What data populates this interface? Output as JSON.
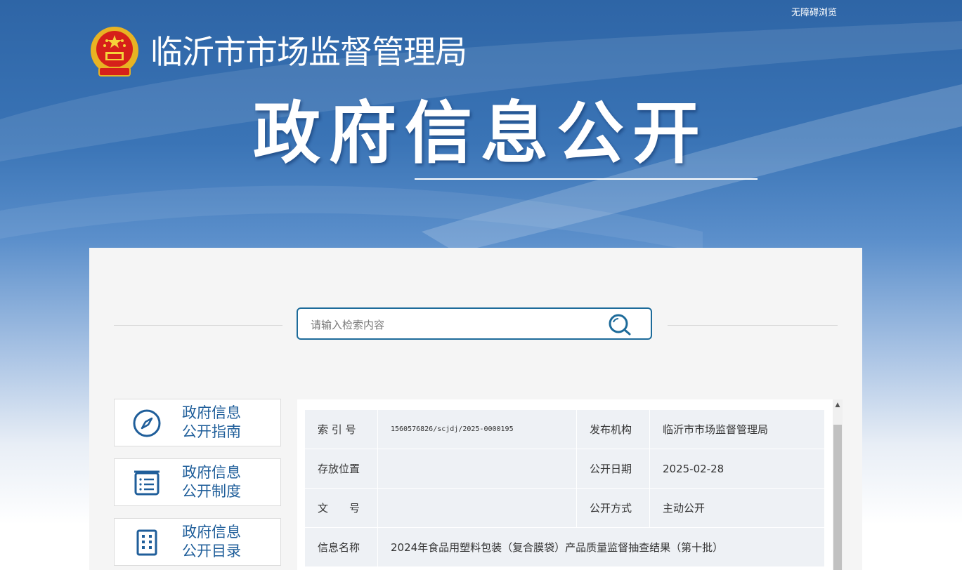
{
  "header": {
    "accessibility_link": "无障碍浏览",
    "site_title": "临沂市市场监督管理局",
    "hero_title": "政府信息公开"
  },
  "search": {
    "placeholder": "请输入检索内容"
  },
  "nav": [
    {
      "line1": "政府信息",
      "line2": "公开指南",
      "icon": "compass-icon"
    },
    {
      "line1": "政府信息",
      "line2": "公开制度",
      "icon": "list-document-icon"
    },
    {
      "line1": "政府信息",
      "line2": "公开目录",
      "icon": "grid-directory-icon"
    }
  ],
  "info": {
    "index_label": "索 引 号",
    "index_value": "1560576826/scjdj/2025-0000195",
    "publisher_label": "发布机构",
    "publisher_value": "临沂市市场监督管理局",
    "location_label": "存放位置",
    "location_value": "",
    "date_label": "公开日期",
    "date_value": "2025-02-28",
    "doc_no_label": "文　　号",
    "doc_no_value": "",
    "mode_label": "公开方式",
    "mode_value": "主动公开",
    "name_label": "信息名称",
    "name_value": "2024年食品用塑料包装（复合膜袋）产品质量监督抽查结果（第十批）"
  },
  "colors": {
    "accent": "#1f5e9a",
    "search_border": "#1d6b9a",
    "table_bg": "#eef1f5"
  }
}
